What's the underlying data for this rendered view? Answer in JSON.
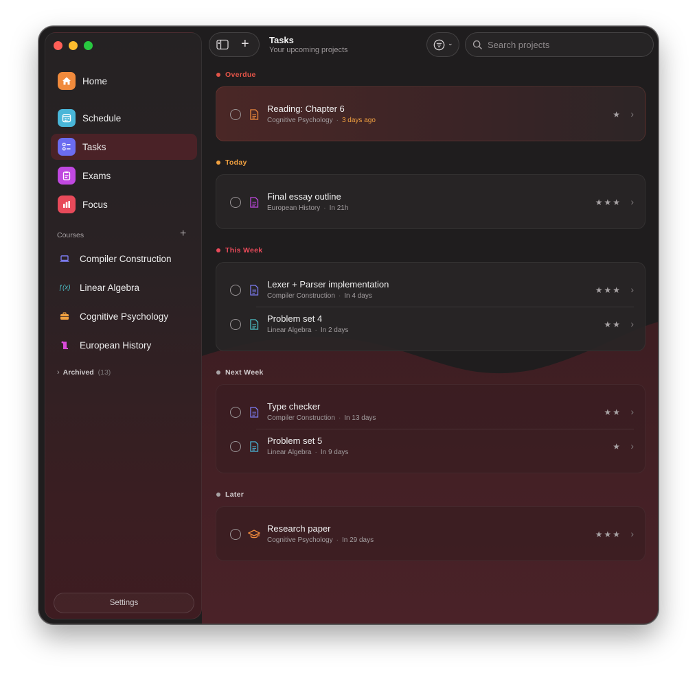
{
  "header": {
    "title": "Tasks",
    "subtitle": "Your upcoming projects"
  },
  "search": {
    "placeholder": "Search projects"
  },
  "sidebar": {
    "nav": [
      {
        "label": "Home",
        "icon": "house-icon",
        "color": "#f08a3c"
      },
      {
        "label": "Schedule",
        "icon": "calendar-icon",
        "color": "#49b6d8"
      },
      {
        "label": "Tasks",
        "icon": "checklist-icon",
        "color": "#6b6cf0",
        "active": true
      },
      {
        "label": "Exams",
        "icon": "clipboard-icon",
        "color": "#c048e0"
      },
      {
        "label": "Focus",
        "icon": "bar-chart-icon",
        "color": "#e84a5a"
      }
    ],
    "courses_label": "Courses",
    "courses": [
      {
        "label": "Compiler Construction",
        "icon": "laptop-icon",
        "color": "#7d7cf2"
      },
      {
        "label": "Linear Algebra",
        "icon": "function-icon",
        "color": "#4cc0c8"
      },
      {
        "label": "Cognitive Psychology",
        "icon": "briefcase-icon",
        "color": "#f0a040"
      },
      {
        "label": "European History",
        "icon": "scroll-icon",
        "color": "#d94ad8"
      }
    ],
    "archived_label": "Archived",
    "archived_count": "(13)",
    "settings_label": "Settings"
  },
  "sections": [
    {
      "label": "Overdue",
      "color": "#e25448",
      "tasks": [
        {
          "title": "Reading: Chapter 6",
          "course": "Cognitive Psychology",
          "due": "3 days ago",
          "stars": "★",
          "icon_color": "#f08a3c",
          "due_color": "#f0a040"
        }
      ]
    },
    {
      "label": "Today",
      "color": "#f0a040",
      "tasks": [
        {
          "title": "Final essay outline",
          "course": "European History",
          "due": "In 21h",
          "stars": "★★★",
          "icon_color": "#c048e0"
        }
      ]
    },
    {
      "label": "This Week",
      "color": "#e84a5a",
      "tasks": [
        {
          "title": "Lexer + Parser implementation",
          "course": "Compiler Construction",
          "due": "In 4 days",
          "stars": "★★★",
          "icon_color": "#7d7cf2"
        },
        {
          "title": "Problem set 4",
          "course": "Linear Algebra",
          "due": "In 2 days",
          "stars": "★★",
          "icon_color": "#4cc0c8"
        }
      ]
    },
    {
      "label": "Next Week",
      "color": "#a8a3a5",
      "tasks": [
        {
          "title": "Type checker",
          "course": "Compiler Construction",
          "due": "In 13 days",
          "stars": "★★",
          "icon_color": "#7d7cf2"
        },
        {
          "title": "Problem set 5",
          "course": "Linear Algebra",
          "due": "In 9 days",
          "stars": "★",
          "icon_color": "#49b6d8"
        }
      ]
    },
    {
      "label": "Later",
      "color": "#a8a3a5",
      "tasks": [
        {
          "title": "Research paper",
          "course": "Cognitive Psychology",
          "due": "In 29 days",
          "stars": "★★★",
          "icon_color": "#f08a3c"
        }
      ]
    }
  ]
}
